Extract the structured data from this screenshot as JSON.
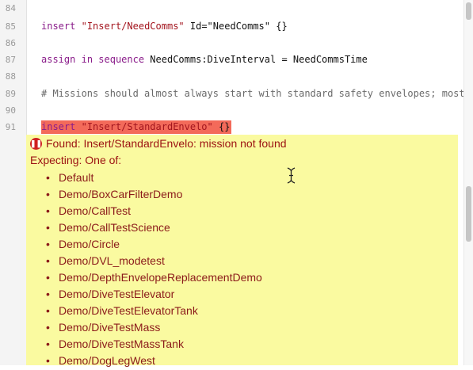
{
  "gutter": {
    "line_numbers": [
      "84",
      "85",
      "86",
      "87",
      "88",
      "89",
      "90",
      "91"
    ]
  },
  "editor": {
    "line85": {
      "kw": "insert",
      "str": "\"Insert/NeedComms\"",
      "rest": " Id=\"NeedComms\" {}"
    },
    "line87": {
      "kw": "assign",
      "kw2": "in sequence",
      "rest": " NeedComms:DiveInterval = NeedCommsTime"
    },
    "line89": {
      "comment": "# Missions should almost always start with standard safety envelopes; most"
    },
    "line91": {
      "kw": "insert",
      "str": "\"Insert/StandardEnvelo\"",
      "rest": " {}"
    }
  },
  "error": {
    "icon": "error-icon",
    "message": "Found: Insert/StandardEnvelo: mission not found",
    "expecting_label": "Expecting: One of:",
    "options": [
      "Default",
      "Demo/BoxCarFilterDemo",
      "Demo/CallTest",
      "Demo/CallTestScience",
      "Demo/Circle",
      "Demo/DVL_modetest",
      "Demo/DepthEnvelopeReplacementDemo",
      "Demo/DiveTestElevator",
      "Demo/DiveTestElevatorTank",
      "Demo/DiveTestMass",
      "Demo/DiveTestMassTank",
      "Demo/DogLegWest"
    ]
  },
  "colors": {
    "error_highlight": "#f36a5a",
    "panel_background": "#fafaa0",
    "error_text": "#9b1111"
  }
}
